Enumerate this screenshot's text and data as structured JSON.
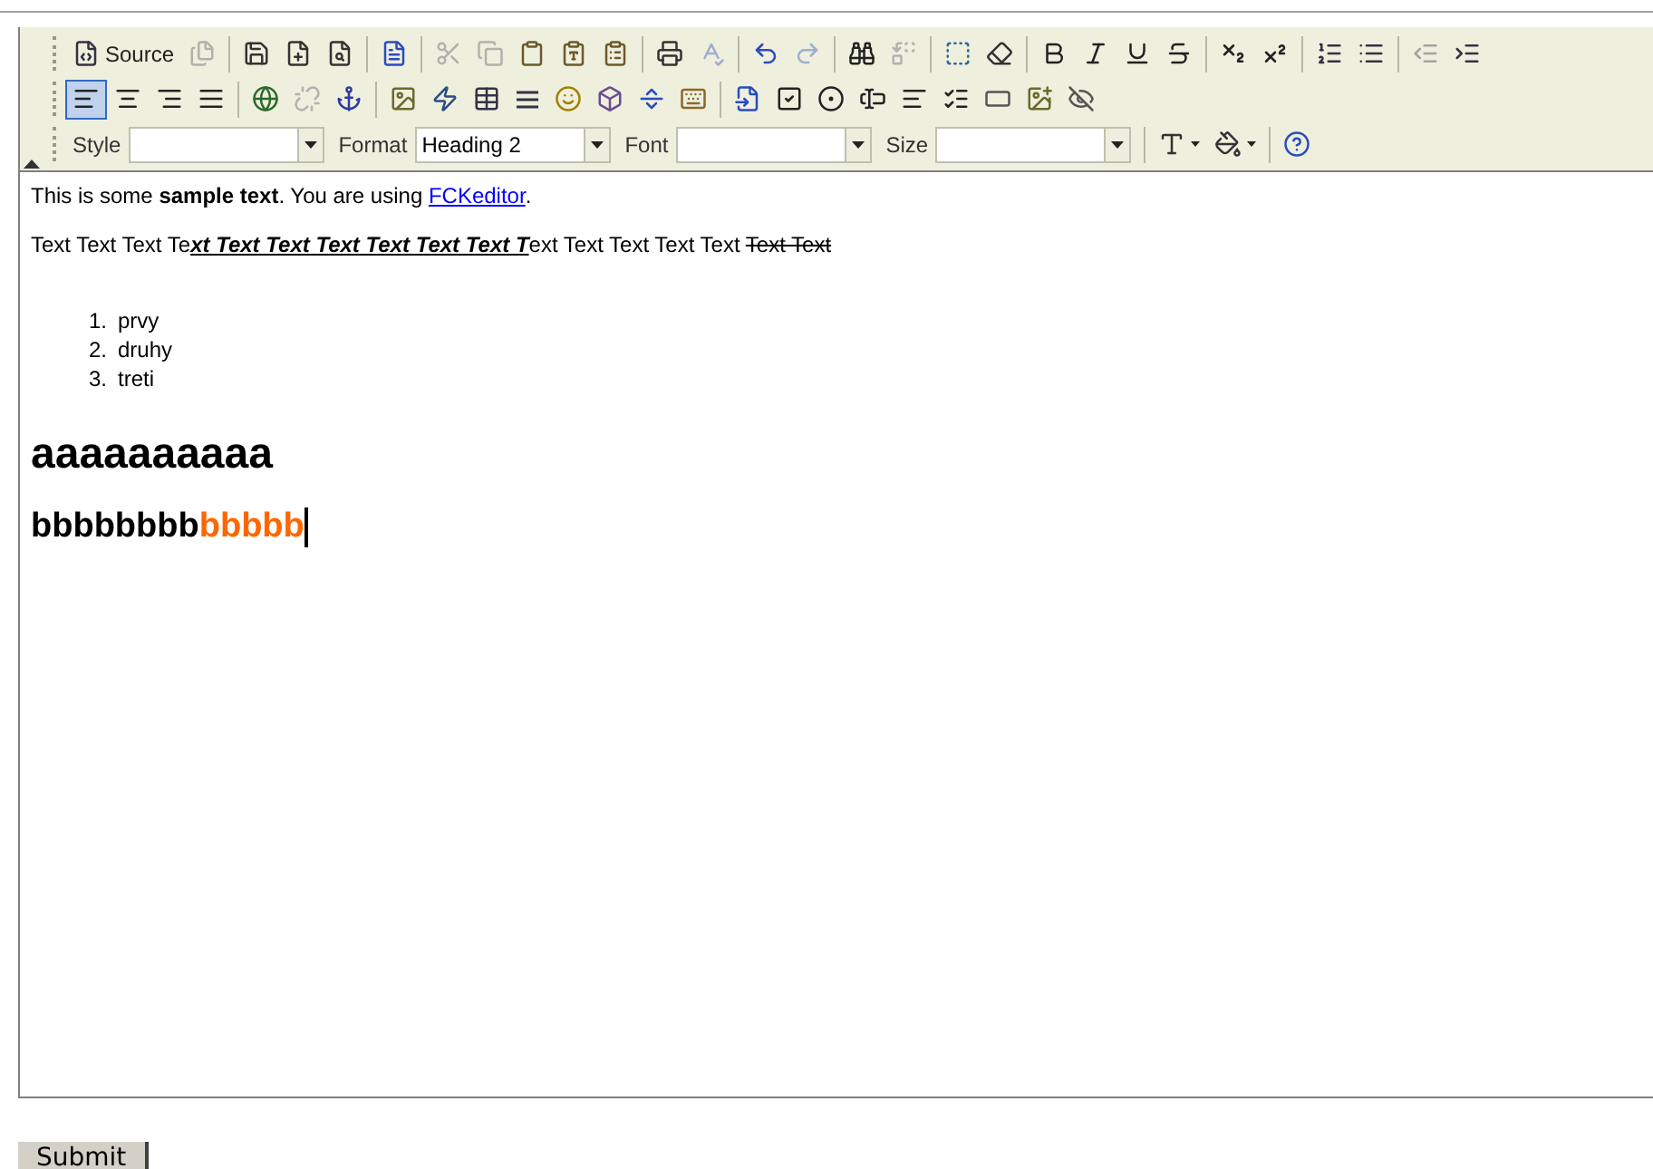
{
  "toolbar_rows": [
    [
      {
        "kind": "source",
        "label": "Source",
        "disabled": false
      },
      {
        "kind": "docprops",
        "disabled": true
      },
      {
        "kind": "sep"
      },
      {
        "kind": "save",
        "disabled": false
      },
      {
        "kind": "newpage",
        "disabled": false
      },
      {
        "kind": "preview",
        "disabled": false
      },
      {
        "kind": "sep"
      },
      {
        "kind": "templates",
        "disabled": false
      },
      {
        "kind": "sep"
      },
      {
        "kind": "cut",
        "disabled": true
      },
      {
        "kind": "copy",
        "disabled": true
      },
      {
        "kind": "paste",
        "disabled": false
      },
      {
        "kind": "pastetext",
        "disabled": false
      },
      {
        "kind": "pasteword",
        "disabled": false
      },
      {
        "kind": "sep"
      },
      {
        "kind": "print",
        "disabled": false
      },
      {
        "kind": "spellcheck",
        "disabled": true
      },
      {
        "kind": "sep"
      },
      {
        "kind": "undo",
        "disabled": false
      },
      {
        "kind": "redo",
        "disabled": true
      },
      {
        "kind": "sep"
      },
      {
        "kind": "find",
        "disabled": false
      },
      {
        "kind": "replace",
        "disabled": true
      },
      {
        "kind": "sep"
      },
      {
        "kind": "selectall",
        "disabled": false
      },
      {
        "kind": "removeformat",
        "disabled": false
      },
      {
        "kind": "sep"
      },
      {
        "kind": "bold",
        "disabled": false
      },
      {
        "kind": "italic",
        "disabled": false
      },
      {
        "kind": "underline",
        "disabled": false
      },
      {
        "kind": "strike",
        "disabled": false
      },
      {
        "kind": "sep"
      },
      {
        "kind": "subscript",
        "disabled": false
      },
      {
        "kind": "superscript",
        "disabled": false
      },
      {
        "kind": "sep"
      },
      {
        "kind": "orderedlist",
        "disabled": false
      },
      {
        "kind": "bulletlist",
        "disabled": false
      },
      {
        "kind": "sep"
      },
      {
        "kind": "outdent",
        "disabled": true
      },
      {
        "kind": "indent",
        "disabled": false
      }
    ],
    [
      {
        "kind": "alignleft",
        "disabled": false,
        "selected": true
      },
      {
        "kind": "aligncenter",
        "disabled": false,
        "selected": false
      },
      {
        "kind": "alignright",
        "disabled": false,
        "selected": false
      },
      {
        "kind": "justify",
        "disabled": false,
        "selected": false
      },
      {
        "kind": "sep"
      },
      {
        "kind": "link",
        "disabled": false
      },
      {
        "kind": "unlink",
        "disabled": true
      },
      {
        "kind": "anchor",
        "disabled": false
      },
      {
        "kind": "sep"
      },
      {
        "kind": "image",
        "disabled": false
      },
      {
        "kind": "flash",
        "disabled": false
      },
      {
        "kind": "table",
        "disabled": false
      },
      {
        "kind": "rule",
        "disabled": false
      },
      {
        "kind": "smiley",
        "disabled": false
      },
      {
        "kind": "specialchar",
        "disabled": false
      },
      {
        "kind": "pagebreak",
        "disabled": false
      },
      {
        "kind": "keyboard",
        "disabled": false
      },
      {
        "kind": "sep"
      },
      {
        "kind": "form",
        "disabled": false
      },
      {
        "kind": "checkbox",
        "disabled": false
      },
      {
        "kind": "radio",
        "disabled": false
      },
      {
        "kind": "textfield",
        "disabled": false
      },
      {
        "kind": "textarea",
        "disabled": false
      },
      {
        "kind": "select",
        "disabled": false
      },
      {
        "kind": "button",
        "disabled": false
      },
      {
        "kind": "imagebutton",
        "disabled": false
      },
      {
        "kind": "hidden",
        "disabled": false
      }
    ],
    [
      {
        "kind": "combo",
        "label": "Style"
      },
      {
        "kind": "combo",
        "label": "Format",
        "value": "Heading 2"
      },
      {
        "kind": "combo",
        "label": "Font"
      },
      {
        "kind": "combo",
        "label": "Size"
      },
      {
        "kind": "sep"
      },
      {
        "kind": "textcolor",
        "disabled": false
      },
      {
        "kind": "bgcolor",
        "disabled": false
      },
      {
        "kind": "sep"
      },
      {
        "kind": "about",
        "disabled": false
      }
    ]
  ],
  "content": [
    {
      "kind": "paragraph",
      "segments": [
        {
          "text": "This is some ",
          "kind": "plain"
        },
        {
          "text": "sample text",
          "kind": "bold"
        },
        {
          "text": ". You are using ",
          "kind": "plain"
        },
        {
          "text": "FCKeditor",
          "kind": "link"
        },
        {
          "text": ".",
          "kind": "plain"
        }
      ]
    },
    {
      "kind": "paragraph",
      "segments": [
        {
          "text": "Text Text Text Te",
          "kind": "plain"
        },
        {
          "text": "xt Text Text Text Text Text Text T",
          "kind": "emphasis"
        },
        {
          "text": "ext Text Text Text Text ",
          "kind": "plain"
        },
        {
          "text": "Text Text",
          "kind": "strike"
        }
      ]
    },
    {
      "kind": "numbered_list",
      "items": [
        {
          "number": "1.",
          "text": "prvy"
        },
        {
          "number": "2.",
          "text": "druhy"
        },
        {
          "number": "3.",
          "text": "treti"
        }
      ]
    },
    {
      "kind": "heading2",
      "segments": [
        {
          "text": "aaaaaaaaaa",
          "kind": "plain"
        }
      ]
    },
    {
      "kind": "heading3",
      "caret": true,
      "segments": [
        {
          "text": "bbbbbbbb",
          "kind": "plain"
        },
        {
          "text": "bbbbb",
          "kind": "colored",
          "color": "#ff6600"
        }
      ]
    }
  ],
  "submit": {
    "label": "Submit"
  }
}
